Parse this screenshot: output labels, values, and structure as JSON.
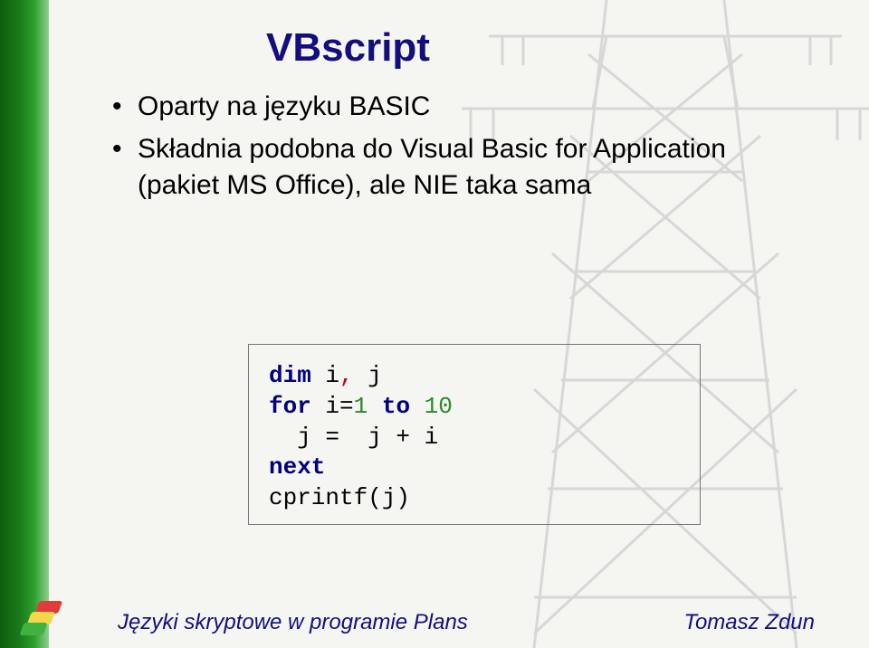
{
  "title": "VBscript",
  "bullets": [
    "Oparty na języku BASIC",
    "Składnia podobna do Visual Basic for Application (pakiet MS Office), ale NIE taka sama"
  ],
  "code": {
    "l1_kw": "dim",
    "l1_rest": " i",
    "l1_comma": ",",
    "l1_j": " j",
    "l2_kw": "for",
    "l2_a": " i=",
    "l2_one": "1",
    "l2_to": " to ",
    "l2_ten": "10",
    "l3": "  j =  j + i",
    "l4_kw": "next",
    "l5": "cprintf(j)"
  },
  "footer": {
    "left": "Języki skryptowe w programie Plans",
    "right": "Tomasz Zdun"
  }
}
